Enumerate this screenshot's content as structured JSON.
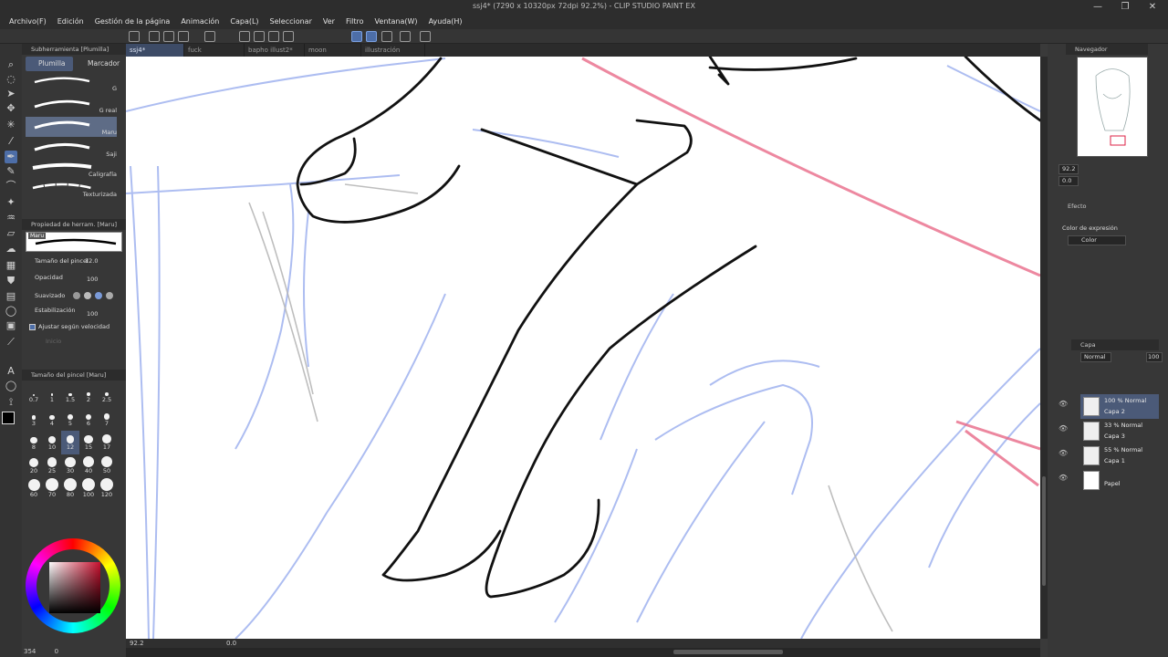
{
  "app": {
    "title": "ssj4* (7290 x 10320px 72dpi 92.2%) - CLIP STUDIO PAINT EX",
    "window_buttons": [
      "—",
      "❐",
      "✕"
    ]
  },
  "menu": [
    "Archivo(F)",
    "Edición",
    "Gestión de la página",
    "Animación",
    "Capa(L)",
    "Seleccionar",
    "Ver",
    "Filtro",
    "Ventana(W)",
    "Ayuda(H)"
  ],
  "tabs": [
    {
      "label": "ssj4*",
      "active": true
    },
    {
      "label": "fuck",
      "active": false
    },
    {
      "label": "bapho illust2*",
      "active": false
    },
    {
      "label": "moon",
      "active": false
    },
    {
      "label": "illustración",
      "active": false
    }
  ],
  "subtool_panel": {
    "title": "Subherramienta [Plumilla]",
    "tabs": [
      "Plumilla",
      "Marcador"
    ],
    "brushes": [
      {
        "label": "G",
        "selected": false
      },
      {
        "label": "G real",
        "selected": false
      },
      {
        "label": "Maru",
        "selected": true
      },
      {
        "label": "Saji",
        "selected": false
      },
      {
        "label": "Caligrafía",
        "selected": false
      },
      {
        "label": "Texturizada",
        "selected": false
      }
    ]
  },
  "tool_property": {
    "title": "Propiedad de herram. [Maru]",
    "preview_label": "Maru",
    "brush_size_label": "Tamaño del pincel",
    "brush_size_value": "12.0",
    "opacity_label": "Opacidad",
    "opacity_value": "100",
    "smoothing_label": "Suavizado",
    "stabilization_label": "Estabilización",
    "stabilization_value": "100",
    "velocity_label": "Ajustar según velocidad",
    "velocity_checked": true,
    "greyed_label": "Inicio"
  },
  "brush_size_panel": {
    "title": "Tamaño del pincel [Maru]",
    "sizes": [
      "0.7",
      "1",
      "1.5",
      "2",
      "2.5",
      "3",
      "4",
      "5",
      "6",
      "7",
      "8",
      "10",
      "12",
      "15",
      "17",
      "20",
      "25",
      "30",
      "40",
      "50",
      "60",
      "70",
      "80",
      "100",
      "120"
    ],
    "selected": "12"
  },
  "color": {
    "main": "#000000",
    "sub": "#ffffff",
    "wheel_hue": "#c8102e"
  },
  "navigator": {
    "title": "Navegador",
    "zoom": "92.2",
    "rotation": "0.0"
  },
  "effect_panel": {
    "title": "Efecto",
    "expression_label": "Color de expresión",
    "expression_value": "Color"
  },
  "layer_panel": {
    "title": "Capa",
    "blend_mode": "Normal",
    "opacity": "100",
    "layers": [
      {
        "name": "Capa 2",
        "info": "100 % Normal",
        "selected": true,
        "editing": true
      },
      {
        "name": "Capa 3",
        "info": "33 % Normal",
        "selected": false,
        "editing": false
      },
      {
        "name": "Capa 1",
        "info": "55 % Normal",
        "selected": false,
        "editing": false
      },
      {
        "name": "Papel",
        "info": "",
        "selected": false,
        "editing": false
      }
    ]
  },
  "status": {
    "zoom": "92.2",
    "rotation": "0.0",
    "bottom_left_value": "354",
    "bottom_left_value2": "0"
  }
}
